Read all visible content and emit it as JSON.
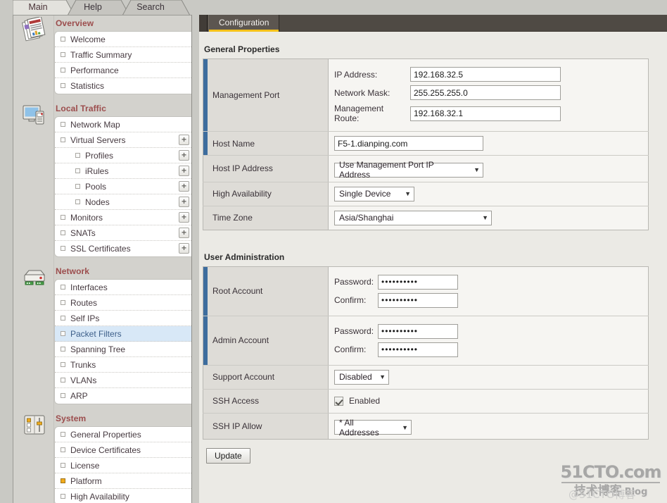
{
  "top_tabs": [
    {
      "label": "Main",
      "active": true
    },
    {
      "label": "Help",
      "active": false
    },
    {
      "label": "Search",
      "active": false
    }
  ],
  "content_tab": {
    "label": "Configuration"
  },
  "sidebar": {
    "groups": [
      {
        "title": "Overview",
        "icon": "reports-icon",
        "items": [
          {
            "label": "Welcome",
            "expand": false,
            "selected": false,
            "current": false,
            "indent": false
          },
          {
            "label": "Traffic Summary",
            "expand": false,
            "selected": false,
            "current": false,
            "indent": false
          },
          {
            "label": "Performance",
            "expand": false,
            "selected": false,
            "current": false,
            "indent": false
          },
          {
            "label": "Statistics",
            "expand": false,
            "selected": false,
            "current": false,
            "indent": false
          }
        ]
      },
      {
        "title": "Local Traffic",
        "icon": "monitor-device-icon",
        "items": [
          {
            "label": "Network Map",
            "expand": false,
            "selected": false,
            "current": false,
            "indent": false
          },
          {
            "label": "Virtual Servers",
            "expand": true,
            "selected": false,
            "current": false,
            "indent": false
          },
          {
            "label": "Profiles",
            "expand": true,
            "selected": false,
            "current": false,
            "indent": true
          },
          {
            "label": "iRules",
            "expand": true,
            "selected": false,
            "current": false,
            "indent": true
          },
          {
            "label": "Pools",
            "expand": true,
            "selected": false,
            "current": false,
            "indent": true
          },
          {
            "label": "Nodes",
            "expand": true,
            "selected": false,
            "current": false,
            "indent": true
          },
          {
            "label": "Monitors",
            "expand": true,
            "selected": false,
            "current": false,
            "indent": false
          },
          {
            "label": "SNATs",
            "expand": true,
            "selected": false,
            "current": false,
            "indent": false
          },
          {
            "label": "SSL Certificates",
            "expand": true,
            "selected": false,
            "current": false,
            "indent": false
          }
        ]
      },
      {
        "title": "Network",
        "icon": "network-appliance-icon",
        "items": [
          {
            "label": "Interfaces",
            "expand": false,
            "selected": false,
            "current": false,
            "indent": false
          },
          {
            "label": "Routes",
            "expand": false,
            "selected": false,
            "current": false,
            "indent": false
          },
          {
            "label": "Self IPs",
            "expand": false,
            "selected": false,
            "current": false,
            "indent": false
          },
          {
            "label": "Packet Filters",
            "expand": false,
            "selected": true,
            "current": false,
            "indent": false
          },
          {
            "label": "Spanning Tree",
            "expand": false,
            "selected": false,
            "current": false,
            "indent": false
          },
          {
            "label": "Trunks",
            "expand": false,
            "selected": false,
            "current": false,
            "indent": false
          },
          {
            "label": "VLANs",
            "expand": false,
            "selected": false,
            "current": false,
            "indent": false
          },
          {
            "label": "ARP",
            "expand": false,
            "selected": false,
            "current": false,
            "indent": false
          }
        ]
      },
      {
        "title": "System",
        "icon": "system-sliders-icon",
        "items": [
          {
            "label": "General Properties",
            "expand": false,
            "selected": false,
            "current": false,
            "indent": false
          },
          {
            "label": "Device Certificates",
            "expand": false,
            "selected": false,
            "current": false,
            "indent": false
          },
          {
            "label": "License",
            "expand": false,
            "selected": false,
            "current": false,
            "indent": false
          },
          {
            "label": "Platform",
            "expand": false,
            "selected": false,
            "current": true,
            "indent": false
          },
          {
            "label": "High Availability",
            "expand": false,
            "selected": false,
            "current": false,
            "indent": false
          }
        ]
      }
    ]
  },
  "general_properties": {
    "title": "General Properties",
    "management_port": {
      "label": "Management Port",
      "ip_address_label": "IP Address:",
      "ip_address_value": "192.168.32.5",
      "network_mask_label": "Network Mask:",
      "network_mask_value": "255.255.255.0",
      "management_route_label": "Management Route:",
      "management_route_value": "192.168.32.1"
    },
    "host_name": {
      "label": "Host Name",
      "value": "F5-1.dianping.com"
    },
    "host_ip_address": {
      "label": "Host IP Address",
      "value": "Use Management Port IP Address"
    },
    "high_availability": {
      "label": "High Availability",
      "value": "Single Device"
    },
    "time_zone": {
      "label": "Time Zone",
      "value": "Asia/Shanghai"
    }
  },
  "user_administration": {
    "title": "User Administration",
    "root_account": {
      "label": "Root Account",
      "password_label": "Password:",
      "password_value": "••••••••••",
      "confirm_label": "Confirm:",
      "confirm_value": "••••••••••"
    },
    "admin_account": {
      "label": "Admin Account",
      "password_label": "Password:",
      "password_value": "••••••••••",
      "confirm_label": "Confirm:",
      "confirm_value": "••••••••••"
    },
    "support_account": {
      "label": "Support Account",
      "value": "Disabled"
    },
    "ssh_access": {
      "label": "SSH Access",
      "checkbox_label": "Enabled",
      "checked": true
    },
    "ssh_ip_allow": {
      "label": "SSH IP Allow",
      "value": "* All Addresses"
    }
  },
  "update_button": {
    "label": "Update"
  },
  "watermark": {
    "top": "51CTO.com",
    "bottom": "技术博客",
    "blog": "Blog",
    "ghost": "@51CTO博客"
  },
  "colors": {
    "accent_blue": "#3d6d9e",
    "tab_underline": "#f5c21a",
    "group_header": "#9c4d4d",
    "selected_row": "#d8e8f7",
    "current_marker": "#f2ab1c"
  }
}
